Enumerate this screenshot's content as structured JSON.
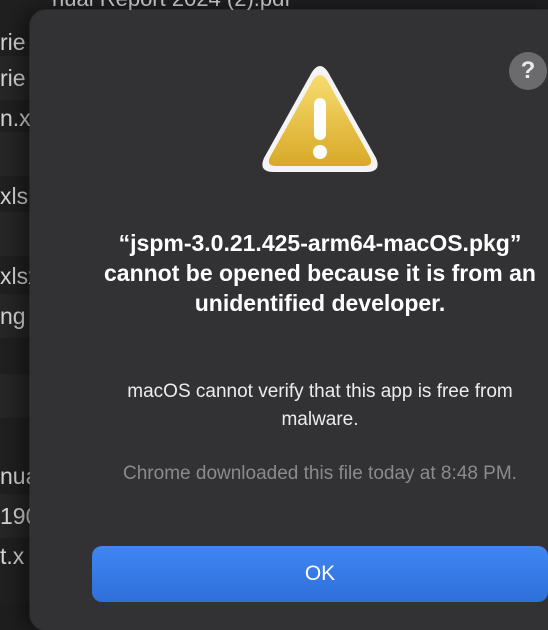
{
  "background": {
    "top_text": "nual Report 2024 (2).pdf",
    "rows": [
      "rie",
      "rie",
      "n.x",
      "",
      "xls",
      "",
      "xlsx",
      "ng",
      "",
      "",
      "nua",
      "190",
      "t.x"
    ]
  },
  "dialog": {
    "help_label": "?",
    "title": "“jspm-3.0.21.425-arm64-macOS.pkg” cannot be opened because it is from an unidentified developer.",
    "message": "macOS cannot verify that this app is free from malware.",
    "info": "Chrome downloaded this file today at 8:48 PM.",
    "ok_label": "OK",
    "icon": "warning-icon"
  },
  "colors": {
    "accent": "#3478f6",
    "warning_yellow": "#f2c94c",
    "dialog_bg": "#323234"
  }
}
